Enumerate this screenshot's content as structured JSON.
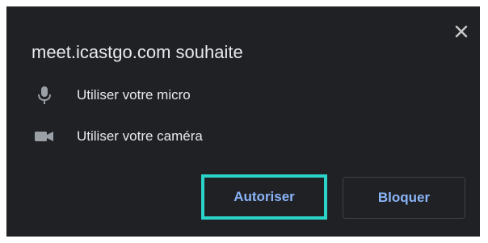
{
  "dialog": {
    "title": "meet.icastgo.com souhaite",
    "close_icon": "close-icon",
    "permissions": [
      {
        "icon": "microphone-icon",
        "label": "Utiliser votre micro"
      },
      {
        "icon": "camera-icon",
        "label": "Utiliser votre caméra"
      }
    ],
    "buttons": {
      "allow_label": "Autoriser",
      "block_label": "Bloquer"
    }
  },
  "colors": {
    "background": "#202124",
    "text": "#e8eaed",
    "icon": "#9aa0a6",
    "button_text": "#8ab4f8",
    "highlight": "#2bd4c9",
    "button_border": "#3c4043"
  }
}
